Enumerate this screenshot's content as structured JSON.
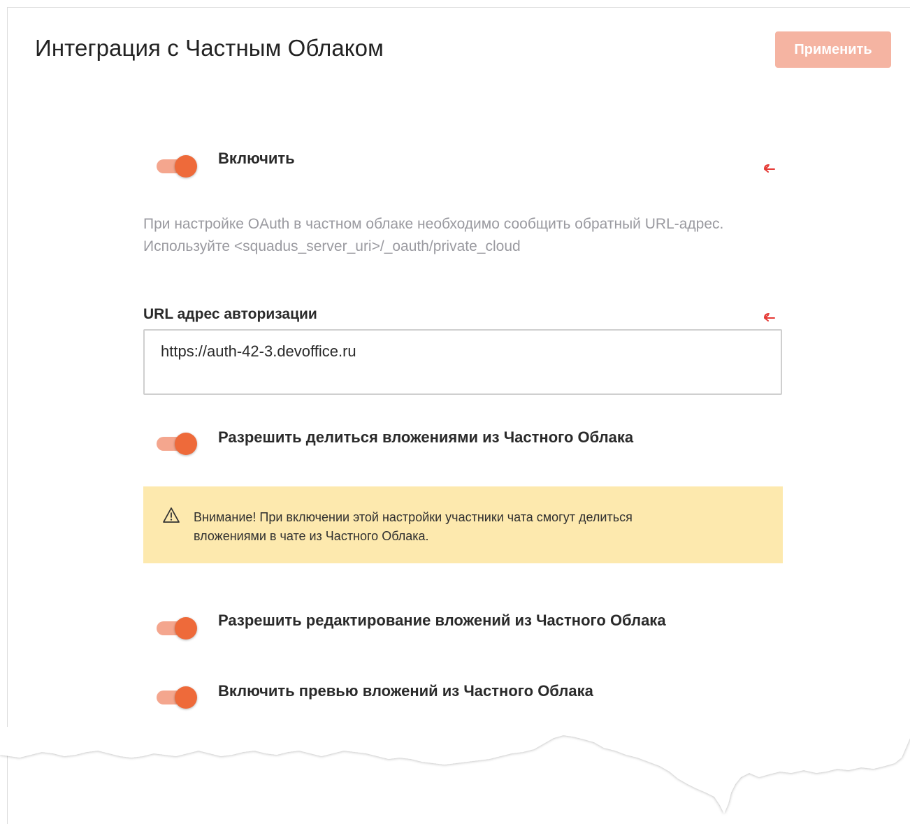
{
  "header": {
    "title": "Интеграция с Частным Облаком",
    "apply_label": "Применить"
  },
  "enable": {
    "label": "Включить",
    "state": "on",
    "reset_icon": "undo-arrow-icon"
  },
  "oauth_hint": {
    "line1": "При настройке OAuth в частном облаке необходимо сообщить обратный URL-адрес.",
    "line2": "Используйте <squadus_server_uri>/_oauth/private_cloud"
  },
  "auth_url": {
    "label": "URL адрес авторизации",
    "value": "https://auth-42-3.devoffice.ru",
    "reset_icon": "undo-arrow-icon"
  },
  "share_attachments": {
    "label": "Разрешить делиться вложениями из Частного Облака",
    "state": "on"
  },
  "warning": {
    "icon": "warning-triangle-icon",
    "line1": "Внимание! При включении этой настройки участники чата смогут делиться",
    "line2": "вложениями в чате из Частного Облака."
  },
  "edit_attachments": {
    "label": "Разрешить редактирование вложений из Частного Облака",
    "state": "on"
  },
  "preview_attachments": {
    "label": "Включить превью вложений из Частного Облака",
    "state": "on"
  },
  "colors": {
    "accent": "#ee6a3a",
    "accent_track": "#f4a68e",
    "apply_disabled": "#f5b4a2",
    "reset_icon": "#e53935",
    "warning_bg": "#fde9ae",
    "hint_text": "#9a9aa0"
  }
}
